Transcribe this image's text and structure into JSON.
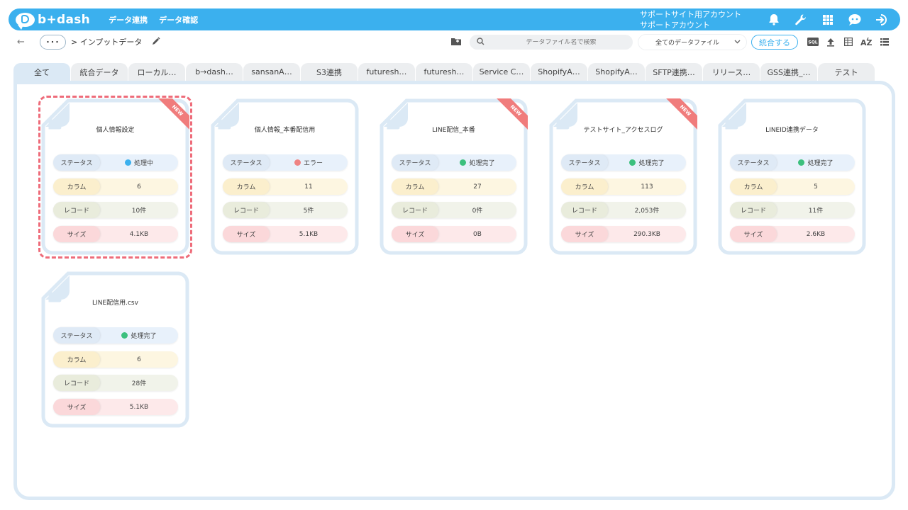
{
  "header": {
    "logo_text": "b+dash",
    "nav": [
      "データ連携",
      "データ確認"
    ],
    "account_line1": "サポートサイト用アカウント",
    "account_line2": "サポートアカウント"
  },
  "subbar": {
    "ellipsis": "･･･",
    "breadcrumb": "> インプットデータ",
    "search_placeholder": "データファイル名で検索",
    "filter_selected": "全てのデータファイル",
    "merge_label": "統合する",
    "sql_label": "SQL"
  },
  "tabs": [
    "全て",
    "統合データ",
    "ローカル…",
    "b→dash…",
    "sansanA…",
    "S3連携",
    "futuresh…",
    "futuresh…",
    "Service C…",
    "ShopifyA…",
    "ShopifyA…",
    "SFTP連携…",
    "リリース…",
    "GSS連携_…",
    "テスト"
  ],
  "labels": {
    "status": "ステータス",
    "column": "カラム",
    "record": "レコード",
    "size": "サイズ",
    "new": "NEW"
  },
  "cards": [
    {
      "title": "個人情報設定",
      "status": "処理中",
      "status_type": "processing",
      "columns": "6",
      "records": "10件",
      "size": "4.1KB",
      "is_new": true
    },
    {
      "title": "個人情報_本番配信用",
      "status": "エラー",
      "status_type": "error",
      "columns": "11",
      "records": "5件",
      "size": "5.1KB",
      "is_new": false
    },
    {
      "title": "LINE配信_本番",
      "status": "処理完了",
      "status_type": "done",
      "columns": "27",
      "records": "0件",
      "size": "0B",
      "is_new": true
    },
    {
      "title": "テストサイト_アクセスログ",
      "status": "処理完了",
      "status_type": "done",
      "columns": "113",
      "records": "2,053件",
      "size": "290.3KB",
      "is_new": true
    },
    {
      "title": "LINEID連携データ",
      "status": "処理完了",
      "status_type": "done",
      "columns": "5",
      "records": "11件",
      "size": "2.6KB",
      "is_new": false
    },
    {
      "title": "LINE配信用.csv",
      "status": "処理完了",
      "status_type": "done",
      "columns": "6",
      "records": "28件",
      "size": "5.1KB",
      "is_new": false
    }
  ],
  "colors": {
    "accent": "#3bb0ee",
    "highlight": "#ee6c7a",
    "done": "#3cc07e",
    "error": "#ef8383"
  }
}
